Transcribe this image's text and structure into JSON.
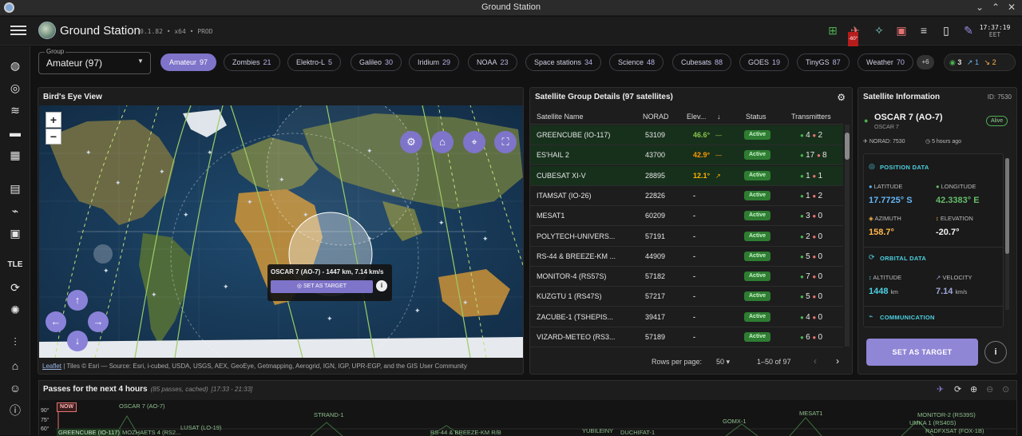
{
  "window": {
    "title": "Ground Station"
  },
  "header": {
    "app_name": "Ground Station",
    "version": "0.1.82 • x64 • PROD",
    "elevation_badge": "-60°",
    "clock_time": "17:37:19",
    "clock_tz": "EET"
  },
  "group": {
    "legend": "Group",
    "value": "Amateur (97)"
  },
  "chips": [
    {
      "name": "Amateur",
      "count": "97"
    },
    {
      "name": "Zombies",
      "count": "21"
    },
    {
      "name": "Elektro-L",
      "count": "5"
    },
    {
      "name": "Galileo",
      "count": "30"
    },
    {
      "name": "Iridium",
      "count": "29"
    },
    {
      "name": "NOAA",
      "count": "23"
    },
    {
      "name": "Space stations",
      "count": "34"
    },
    {
      "name": "Science",
      "count": "48"
    },
    {
      "name": "Cubesats",
      "count": "88"
    },
    {
      "name": "GOES",
      "count": "19"
    },
    {
      "name": "TinyGS",
      "count": "87"
    },
    {
      "name": "Weather",
      "count": "70"
    }
  ],
  "chips_more": "+6",
  "pass_summary": {
    "visible": "3",
    "rising": "1",
    "setting": "2"
  },
  "map": {
    "title": "Bird's Eye View",
    "zoom_in": "+",
    "zoom_out": "−",
    "tooltip_text": "OSCAR 7 (AO-7) - 1447 km, 7.14 km/s",
    "tooltip_button": "SET AS TARGET",
    "attribution_link": "Leaflet",
    "attribution_text": " | Tiles © Esri — Source: Esri, i-cubed, USDA, USGS, AEX, GeoEye, Getmapping, Aerogrid, IGN, IGP, UPR-EGP, and the GIS User Community"
  },
  "table": {
    "title": "Satellite Group Details (97 satellites)",
    "columns": [
      "Satellite Name",
      "NORAD",
      "Elev...",
      "Status",
      "Transmitters"
    ],
    "rows": [
      {
        "name": "GREENCUBE (IO-117)",
        "norad": "53109",
        "elev": "46.6°",
        "trend": "—",
        "elev_color": "#8bc34a",
        "status": "Active",
        "tx_active": "4",
        "tx_inactive": "2",
        "visible": true
      },
      {
        "name": "ES'HAIL 2",
        "norad": "43700",
        "elev": "42.9°",
        "trend": "—",
        "elev_color": "#ff9800",
        "status": "Active",
        "tx_active": "17",
        "tx_inactive": "8",
        "visible": true
      },
      {
        "name": "CUBESAT XI-V",
        "norad": "28895",
        "elev": "12.1°",
        "trend": "↗",
        "elev_color": "#ffb300",
        "status": "Active",
        "tx_active": "1",
        "tx_inactive": "1",
        "visible": true
      },
      {
        "name": "ITAMSAT (IO-26)",
        "norad": "22826",
        "elev": "-",
        "trend": "",
        "elev_color": "#cccccc",
        "status": "Active",
        "tx_active": "1",
        "tx_inactive": "2",
        "visible": false
      },
      {
        "name": "MESAT1",
        "norad": "60209",
        "elev": "-",
        "trend": "",
        "elev_color": "#cccccc",
        "status": "Active",
        "tx_active": "3",
        "tx_inactive": "0",
        "visible": false
      },
      {
        "name": "POLYTECH-UNIVERS...",
        "norad": "57191",
        "elev": "-",
        "trend": "",
        "elev_color": "#cccccc",
        "status": "Active",
        "tx_active": "2",
        "tx_inactive": "0",
        "visible": false
      },
      {
        "name": "RS-44 & BREEZE-KM ...",
        "norad": "44909",
        "elev": "-",
        "trend": "",
        "elev_color": "#cccccc",
        "status": "Active",
        "tx_active": "5",
        "tx_inactive": "0",
        "visible": false
      },
      {
        "name": "MONITOR-4 (RS57S)",
        "norad": "57182",
        "elev": "-",
        "trend": "",
        "elev_color": "#cccccc",
        "status": "Active",
        "tx_active": "7",
        "tx_inactive": "0",
        "visible": false
      },
      {
        "name": "KUZGTU 1 (RS47S)",
        "norad": "57217",
        "elev": "-",
        "trend": "",
        "elev_color": "#cccccc",
        "status": "Active",
        "tx_active": "5",
        "tx_inactive": "0",
        "visible": false
      },
      {
        "name": "ZACUBE-1 (TSHEPIS...",
        "norad": "39417",
        "elev": "-",
        "trend": "",
        "elev_color": "#cccccc",
        "status": "Active",
        "tx_active": "4",
        "tx_inactive": "0",
        "visible": false
      },
      {
        "name": "VIZARD-METEO (RS3...",
        "norad": "57189",
        "elev": "-",
        "trend": "",
        "elev_color": "#cccccc",
        "status": "Active",
        "tx_active": "6",
        "tx_inactive": "0",
        "visible": false
      }
    ],
    "rows_per_page_label": "Rows per page:",
    "rows_per_page": "50",
    "range": "1–50 of 97"
  },
  "info": {
    "title": "Satellite Information",
    "id": "ID: 7530",
    "name": "OSCAR 7 (AO-7)",
    "subname": "OSCAR 7",
    "alive": "Alive",
    "norad": "NORAD: 7530",
    "updated": "5 hours ago",
    "position_title": "POSITION DATA",
    "latitude_label": "LATITUDE",
    "latitude": "17.7725° S",
    "longitude_label": "LONGITUDE",
    "longitude": "42.3383° E",
    "azimuth_label": "AZIMUTH",
    "azimuth": "158.7°",
    "elevation_label": "ELEVATION",
    "elevation": "-20.7°",
    "orbital_title": "ORBITAL DATA",
    "altitude_label": "ALTITUDE",
    "altitude": "1448",
    "altitude_unit": "km",
    "velocity_label": "VELOCITY",
    "velocity": "7.14",
    "velocity_unit": "km/s",
    "comm_title": "COMMUNICATION",
    "target_button": "SET AS TARGET",
    "info_button": "i"
  },
  "passes": {
    "title": "Passes for the next 4 hours",
    "subtitle": "(85 passes, cached)",
    "range": "[17:33 - 21:33]",
    "now": "NOW",
    "axis": [
      "90°",
      "75°",
      "60°"
    ],
    "labels": [
      "OSCAR 7 (AO-7)",
      "STRAND-1",
      "LUSAT (LO-19)",
      "GREENCUBE (IO-117)",
      "MOZHAETS 4 (RS2...",
      "RS-44 & BREEZE-KM R/B",
      "YUBILEINY",
      "DUCHIFAT-1",
      "GOMX-1",
      "MESAT1",
      "MONITOR-2 (RS39S)",
      "UMKA 1 (RS40S)",
      "RADFXSAT (FOX-1B)"
    ]
  },
  "colors": {
    "accent": "#7e74c9",
    "active_green": "#2e7d32",
    "cyan_section": "#4dd0e1",
    "orbit_line": "#9ccc65"
  }
}
